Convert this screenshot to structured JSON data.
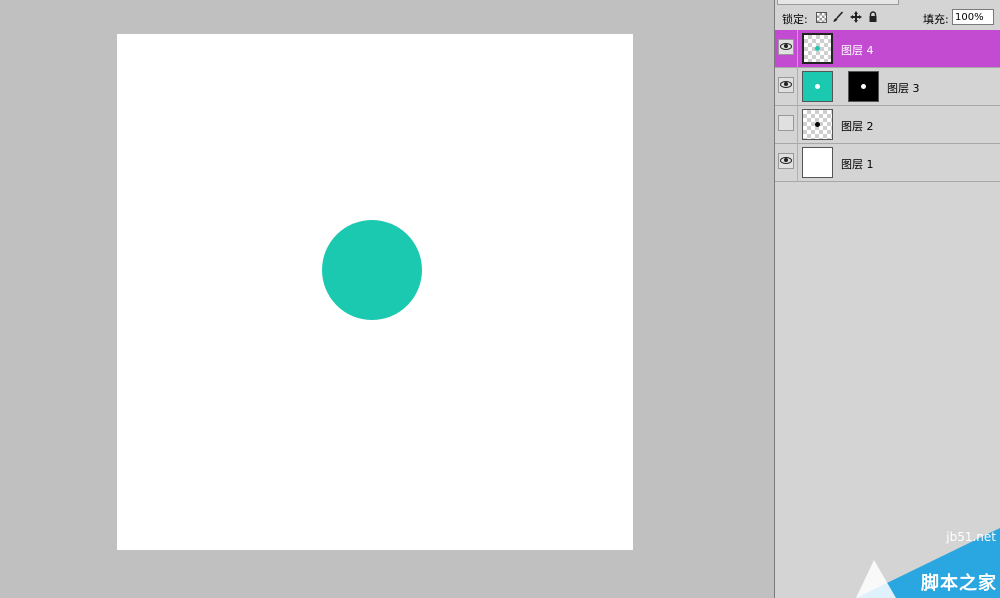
{
  "lock_bar": {
    "lock_label": "锁定:",
    "fill_label": "填充:",
    "fill_value": "100%"
  },
  "layers": [
    {
      "name": "图层 4",
      "visible": true,
      "selected": true,
      "thumb": "transparent-teal-dot"
    },
    {
      "name": "图层 3",
      "visible": true,
      "selected": false,
      "thumb": "teal-fill",
      "mask": "black-white-dot"
    },
    {
      "name": "图层 2",
      "visible": false,
      "selected": false,
      "thumb": "transparent-black-dot"
    },
    {
      "name": "图层 1",
      "visible": true,
      "selected": false,
      "thumb": "white-fill"
    }
  ],
  "icons": {
    "lock_transparent": "lock-transparent-pixels-icon",
    "lock_paint": "brush-icon",
    "lock_move": "move-icon",
    "lock_all": "lock-icon",
    "eye": "eye-icon"
  },
  "colors": {
    "workspace_bg": "#c0c0c0",
    "canvas_bg": "#ffffff",
    "circle": "#1bc8b0",
    "selected_layer": "#c34bd1",
    "panel_bg": "#d4d4d4",
    "watermark": "#2aa6e0"
  },
  "watermark": {
    "domain": "jb51.net",
    "name": "脚本之家"
  }
}
